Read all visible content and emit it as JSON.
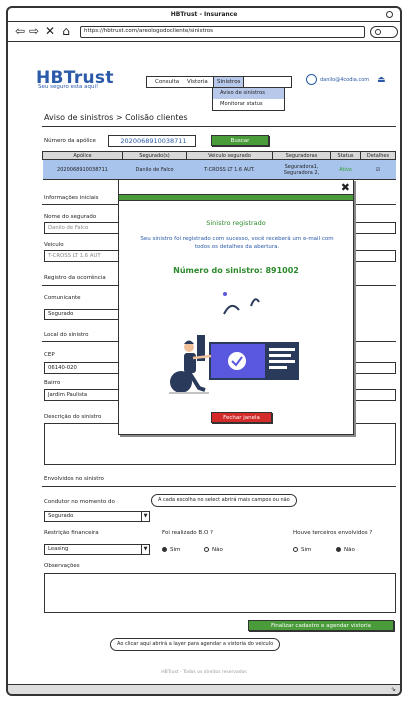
{
  "window": {
    "title": "HBTrust - Insurance",
    "url": "https://hbtrust.com/areologodocliente/sinistros"
  },
  "brand": {
    "name": "HBTrust",
    "tagline": "Seu seguro esta aqui!"
  },
  "menu": {
    "items": [
      "Consulta",
      "Vistoria",
      "Sinistros"
    ],
    "active": "Sinistros"
  },
  "dropdown": {
    "items": [
      "Aviso de sinistros",
      "Monitorar status"
    ]
  },
  "user": {
    "email": "danilo@4codia.com"
  },
  "page": {
    "title": "Aviso de sinistros > Colisão clientes"
  },
  "search": {
    "label": "Número da apólice",
    "value": "2020068910038711",
    "button": "Buscar"
  },
  "table": {
    "headers": [
      "Apólice",
      "Segurado(s)",
      "Veiculo segurado",
      "Seguradoras",
      "Status",
      "Detalhes"
    ],
    "row": [
      "2020068910038711",
      "Danilo de Falco",
      "T-CROSS LT 1.6 AUT.",
      "Seguradora1, Seguradora 2,",
      "Ativo",
      "☑"
    ]
  },
  "form": {
    "initial_info": "Informações iniciais",
    "insured_label": "Nome do segurado",
    "insured_value": "Danilo de Falco",
    "vehicle_label": "Veiculo",
    "vehicle_value": "T-CROSS LT 1.6 AUT",
    "occurrence": "Registro da ocorrência",
    "reporter_label": "Comunicante",
    "reporter_value": "Segurado",
    "location": "Local do sinistro",
    "cep_label": "CEP",
    "cep_value": "06140-020",
    "district_label": "Bairro",
    "district_value": "Jardim Paulista",
    "description_label": "Descrição do sinistro",
    "involved": "Envolvidos no sinistro",
    "driver_label": "Condutor no momento do",
    "driver_value": "Segurado",
    "driver_note": "A cada escolha no select abrirá mais campos ou não",
    "restriction_label": "Restrição financeira",
    "restriction_value": "Leasing",
    "bo_label": "Foi realizado B.O ?",
    "third_label": "Houve terceiros envolvidos ?",
    "yes": "Sim",
    "no": "Não",
    "obs_label": "Observações",
    "submit": "Finalizar cadastro e agendar vistoria",
    "submit_note": "Ao clicar aqui abrirá a layer para agendar a vistoria do veiculo"
  },
  "footer": "HBTrust - Todos os direitos reservados",
  "modal": {
    "title": "Sinistro registrado",
    "message": "Seu sinistro foi registrado com sucesso, você receberá um e-mail com todos os detalhes da abertura.",
    "number": "Número do sinistro: 891002",
    "button": "Fechar janela"
  }
}
